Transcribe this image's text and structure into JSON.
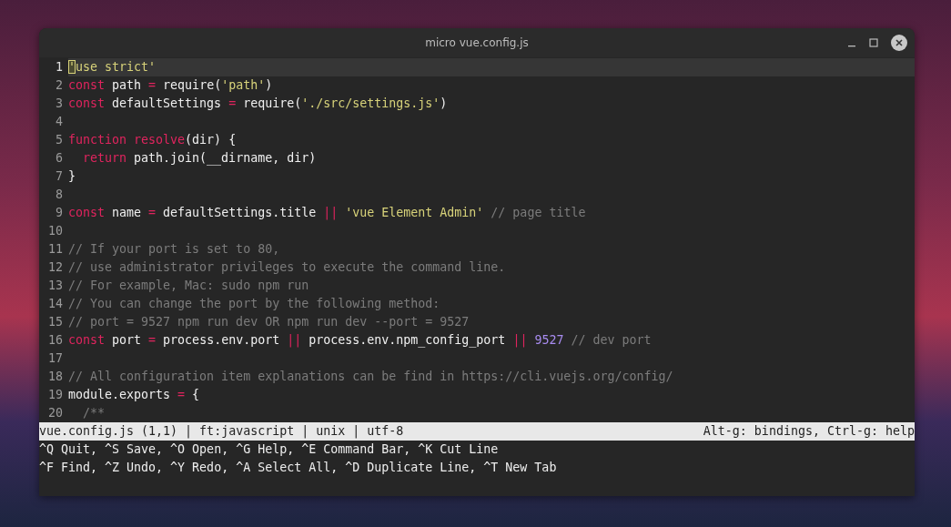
{
  "window": {
    "title": "micro vue.config.js"
  },
  "editor": {
    "lines": [
      {
        "number": "1",
        "current": true,
        "tokens": [
          {
            "text": "'",
            "kind": "string",
            "cursor": true
          },
          {
            "text": "use strict'",
            "kind": "string"
          }
        ]
      },
      {
        "number": "2",
        "current": false,
        "tokens": [
          {
            "text": "const",
            "kind": "keyword"
          },
          {
            "text": " path ",
            "kind": "plain"
          },
          {
            "text": "=",
            "kind": "keyword"
          },
          {
            "text": " require(",
            "kind": "plain"
          },
          {
            "text": "'path'",
            "kind": "string"
          },
          {
            "text": ")",
            "kind": "plain"
          }
        ]
      },
      {
        "number": "3",
        "current": false,
        "tokens": [
          {
            "text": "const",
            "kind": "keyword"
          },
          {
            "text": " defaultSettings ",
            "kind": "plain"
          },
          {
            "text": "=",
            "kind": "keyword"
          },
          {
            "text": " require(",
            "kind": "plain"
          },
          {
            "text": "'./src/settings.js'",
            "kind": "string"
          },
          {
            "text": ")",
            "kind": "plain"
          }
        ]
      },
      {
        "number": "4",
        "current": false
      },
      {
        "number": "5",
        "current": false,
        "tokens": [
          {
            "text": "function",
            "kind": "keyword"
          },
          {
            "text": " resolve",
            "kind": "keyword"
          },
          {
            "text": "(dir) {",
            "kind": "plain"
          }
        ]
      },
      {
        "number": "6",
        "current": false,
        "tokens": [
          {
            "text": "  return",
            "kind": "keyword"
          },
          {
            "text": " path.join(__dirname, dir)",
            "kind": "plain"
          }
        ]
      },
      {
        "number": "7",
        "current": false,
        "tokens": [
          {
            "text": "}",
            "kind": "plain"
          }
        ]
      },
      {
        "number": "8",
        "current": false
      },
      {
        "number": "9",
        "current": false,
        "tokens": [
          {
            "text": "const",
            "kind": "keyword"
          },
          {
            "text": " name ",
            "kind": "plain"
          },
          {
            "text": "=",
            "kind": "keyword"
          },
          {
            "text": " defaultSettings.title ",
            "kind": "plain"
          },
          {
            "text": "||",
            "kind": "keyword"
          },
          {
            "text": " 'vue Element Admin'",
            "kind": "string"
          },
          {
            "text": " // page title",
            "kind": "comment"
          }
        ]
      },
      {
        "number": "10",
        "current": false
      },
      {
        "number": "11",
        "current": false,
        "tokens": [
          {
            "text": "// If your port is set to 80,",
            "kind": "comment"
          }
        ]
      },
      {
        "number": "12",
        "current": false,
        "tokens": [
          {
            "text": "// use administrator privileges to execute the command line.",
            "kind": "comment"
          }
        ]
      },
      {
        "number": "13",
        "current": false,
        "tokens": [
          {
            "text": "// For example, Mac: sudo npm run",
            "kind": "comment"
          }
        ]
      },
      {
        "number": "14",
        "current": false,
        "tokens": [
          {
            "text": "// You can change the port by the following method:",
            "kind": "comment"
          }
        ]
      },
      {
        "number": "15",
        "current": false,
        "tokens": [
          {
            "text": "// port = 9527 npm run dev OR npm run dev --port = 9527",
            "kind": "comment"
          }
        ]
      },
      {
        "number": "16",
        "current": false,
        "tokens": [
          {
            "text": "const",
            "kind": "keyword"
          },
          {
            "text": " port ",
            "kind": "plain"
          },
          {
            "text": "=",
            "kind": "keyword"
          },
          {
            "text": " process.env.port ",
            "kind": "plain"
          },
          {
            "text": "||",
            "kind": "keyword"
          },
          {
            "text": " process.env.npm_config_port ",
            "kind": "plain"
          },
          {
            "text": "||",
            "kind": "keyword"
          },
          {
            "text": " 9527",
            "kind": "number"
          },
          {
            "text": " // dev port",
            "kind": "comment"
          }
        ]
      },
      {
        "number": "17",
        "current": false
      },
      {
        "number": "18",
        "current": false,
        "tokens": [
          {
            "text": "// All configuration item explanations can be find in https://cli.vuejs.org/config/",
            "kind": "comment"
          }
        ]
      },
      {
        "number": "19",
        "current": false,
        "tokens": [
          {
            "text": "module.exports ",
            "kind": "plain"
          },
          {
            "text": "=",
            "kind": "keyword"
          },
          {
            "text": " {",
            "kind": "plain"
          }
        ]
      },
      {
        "number": "20",
        "current": false,
        "tokens": [
          {
            "text": "  /**",
            "kind": "comment"
          }
        ]
      }
    ]
  },
  "status_bar": {
    "left": "vue.config.js (1,1) | ft:javascript | unix | utf-8",
    "right": "Alt-g: bindings, Ctrl-g: help"
  },
  "help_lines": [
    "^Q Quit, ^S Save, ^O Open, ^G Help, ^E Command Bar, ^K Cut Line",
    "^F Find, ^Z Undo, ^Y Redo, ^A Select All, ^D Duplicate Line, ^T New Tab"
  ]
}
